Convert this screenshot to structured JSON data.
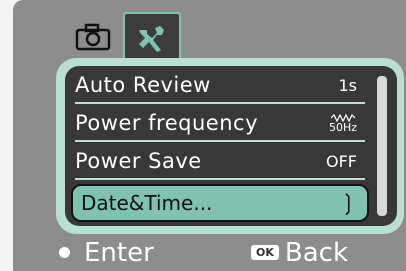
{
  "tabs": [
    {
      "icon": "camera-icon",
      "active": false
    },
    {
      "icon": "setup-tools-icon",
      "active": true
    }
  ],
  "menu": {
    "items": [
      {
        "label": "Auto Review",
        "value": "1s"
      },
      {
        "label": "Power frequency",
        "value": "50Hz",
        "value_icon": "ac-wave-icon"
      },
      {
        "label": "Power Save",
        "value": "OFF"
      },
      {
        "label": "Date&Time...",
        "value": "",
        "selected": true
      }
    ]
  },
  "hints": {
    "enter_label": "Enter",
    "ok_badge": "OK",
    "back_label": "Back"
  },
  "colors": {
    "accent": "#7fc2b0",
    "panel": "#b9ded3",
    "screen": "#383838",
    "frame": "#8d8d8d"
  }
}
